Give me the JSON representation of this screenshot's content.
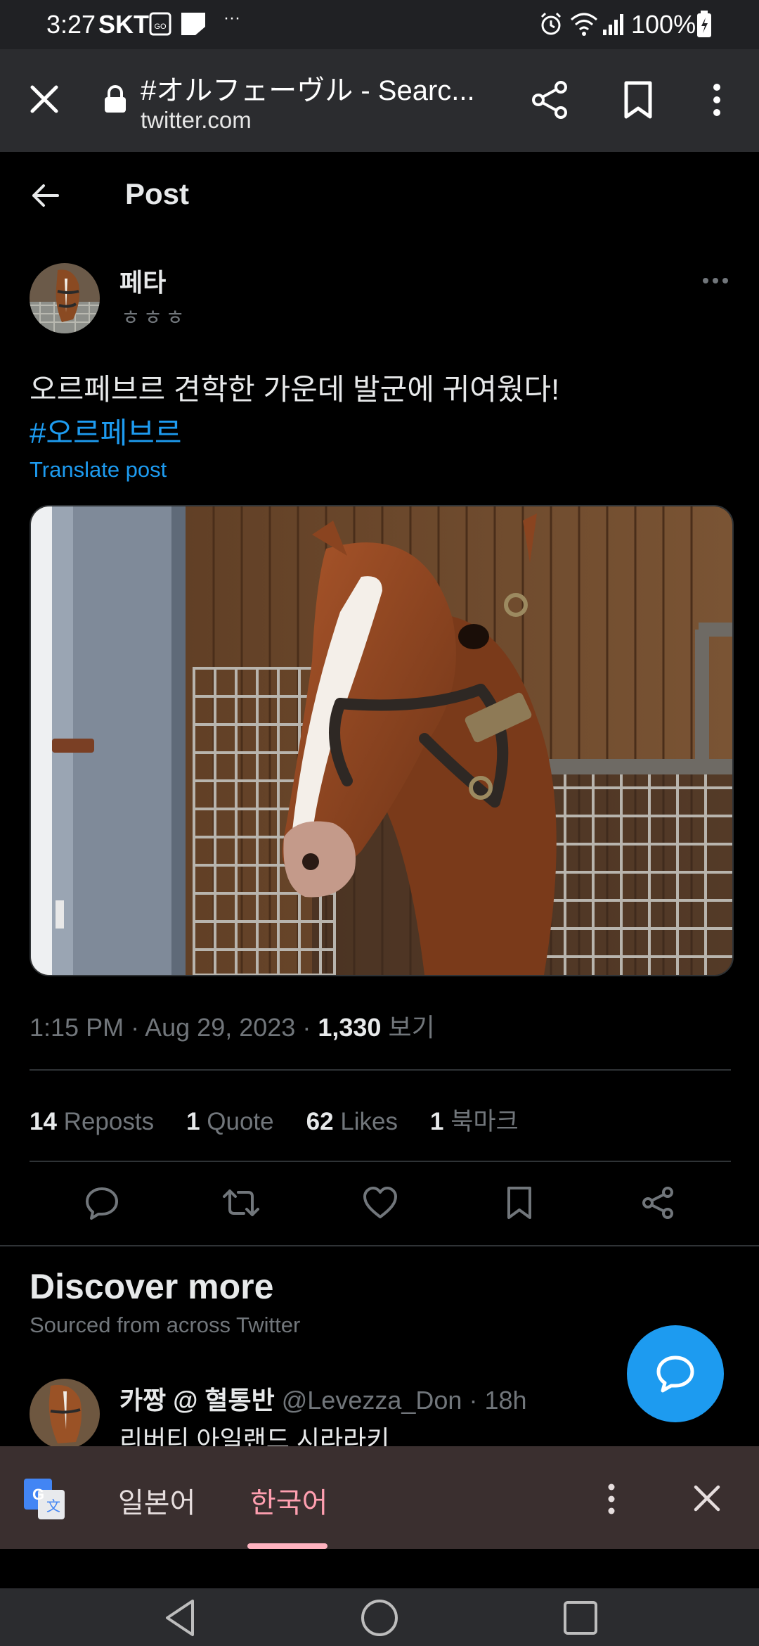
{
  "status_bar": {
    "time": "3:27",
    "carrier": "SKT",
    "more": "···",
    "battery": "100%"
  },
  "browser": {
    "title": "#オルフェーヴル - Searc...",
    "domain": "twitter.com"
  },
  "post_header": {
    "title": "Post"
  },
  "post": {
    "author_name": "페타",
    "author_handle": "ㅎㅎㅎ",
    "text": "오르페브르 견학한 가운데 발군에 귀여웠다!",
    "hashtag": "#오르페브르",
    "translate_label": "Translate post",
    "time": "1:15 PM",
    "date": "Aug 29, 2023",
    "views_count": "1,330",
    "views_label": "보기",
    "separator": "·"
  },
  "stats": {
    "reposts_count": "14",
    "reposts_label": "Reposts",
    "quotes_count": "1",
    "quotes_label": "Quote",
    "likes_count": "62",
    "likes_label": "Likes",
    "bookmarks_count": "1",
    "bookmarks_label": "북마크"
  },
  "discover": {
    "title": "Discover more",
    "subtitle": "Sourced from across Twitter",
    "item": {
      "name": "카짱 @ 혈통반",
      "handle": "@Levezza_Don",
      "time": "· 18h",
      "text": "리버티 아일랜드 시라라키"
    }
  },
  "translate_bar": {
    "source_lang": "일본어",
    "target_lang": "한국어"
  },
  "colors": {
    "accent": "#1d9bf0",
    "background": "#000000",
    "muted_text": "#71767b",
    "translate_active": "#ff9fb0"
  }
}
